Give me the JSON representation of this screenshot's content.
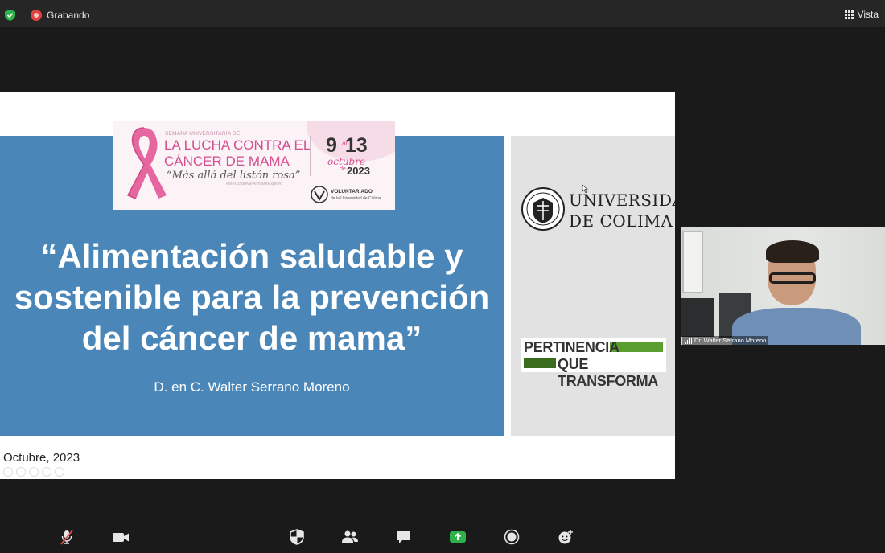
{
  "topbar": {
    "recording_label": "Grabando",
    "view_label": "Vista",
    "security_color": "#2fb24c",
    "recording_color": "#e0433f"
  },
  "slide": {
    "banner": {
      "kicker": "SEMANA UNIVERSITARIA DE",
      "line1": "LA LUCHA CONTRA EL",
      "line2": "CÁNCER DE MAMA",
      "subtitle": "“Más allá del listón rosa”",
      "hashtag": "#MeCuidoMeAmoMeExploro",
      "date_start": "9",
      "date_al": "al",
      "date_end": "13",
      "month": "octubre",
      "month_de": "de",
      "year": "2023",
      "voluntariado": "VOLUNTARIADO",
      "voluntariado_sub": "de la Universidad de Colima"
    },
    "title_line1": "“Alimentación saludable y",
    "title_line2": "sostenible para la prevención",
    "title_line3": "del cáncer de mama”",
    "author": "D. en C. Walter Serrano Moreno",
    "date": "Octubre, 2023",
    "university_line1": "UNIVERSIDAD",
    "university_line2": "DE COLIMA",
    "slogan_line1": "PERTINENCIA",
    "slogan_line2_a": "QUE",
    "slogan_line2_b": "TRANSFORMA",
    "blue_color": "#4a87b8",
    "pink_color": "#d44e91"
  },
  "video": {
    "participant_name": "Dr. Walter Serrano Moreno"
  },
  "toolbar": {
    "icons": [
      "mic-muted-icon",
      "video-camera-icon",
      "security-icon",
      "participants-icon",
      "chat-icon",
      "share-screen-icon",
      "record-icon",
      "reactions-icon"
    ],
    "share_color": "#2fb24c"
  }
}
